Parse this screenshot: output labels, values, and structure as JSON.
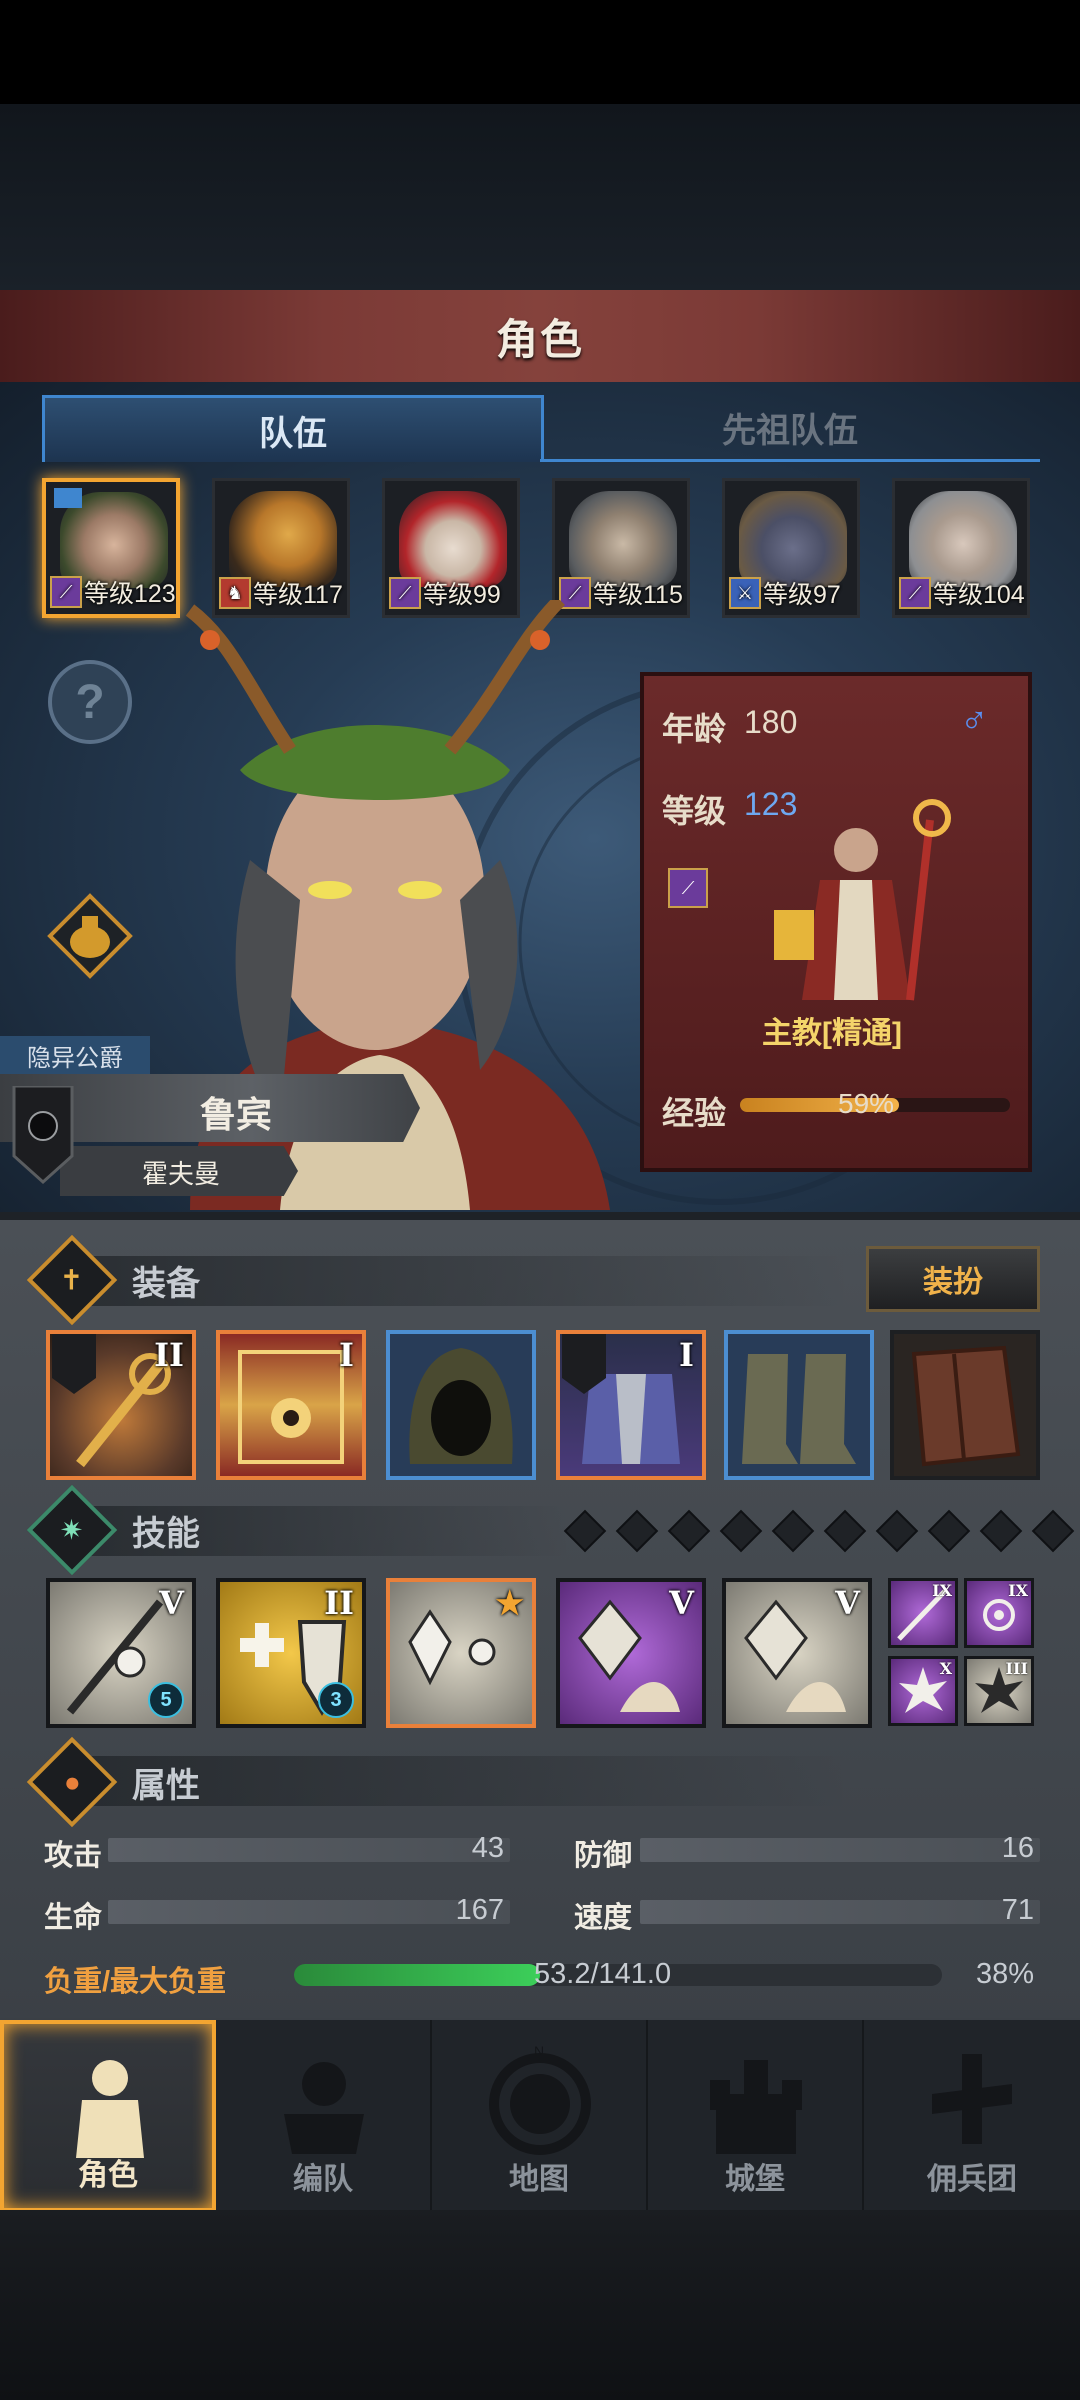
{
  "header": {
    "title": "角色"
  },
  "tabs": [
    {
      "label": "队伍",
      "active": true
    },
    {
      "label": "先祖队伍",
      "active": false
    }
  ],
  "party": [
    {
      "level_text": "等级123",
      "class_icon": "staff-icon",
      "selected": true
    },
    {
      "level_text": "等级117",
      "class_icon": "horse-icon",
      "selected": false
    },
    {
      "level_text": "等级99",
      "class_icon": "staff-icon",
      "selected": false
    },
    {
      "level_text": "等级115",
      "class_icon": "staff-icon",
      "selected": false
    },
    {
      "level_text": "等级97",
      "class_icon": "sword-icon",
      "selected": false
    },
    {
      "level_text": "等级104",
      "class_icon": "staff-icon",
      "selected": false
    }
  ],
  "character": {
    "title": "隐异公爵",
    "name": "鲁宾",
    "surname": "霍夫曼",
    "age_label": "年龄",
    "age": "180",
    "gender_symbol": "♂",
    "level_label": "等级",
    "level": "123",
    "class_name": "主教[精通]",
    "exp_label": "经验",
    "exp_percent": "59%",
    "exp_fraction": 0.59
  },
  "equipment": {
    "section_title": "装备",
    "dress_button": "装扮",
    "slots": [
      {
        "item": "staff",
        "tier": "II",
        "rarity": "orange"
      },
      {
        "item": "tome",
        "tier": "I",
        "rarity": "orange"
      },
      {
        "item": "hood",
        "tier": "",
        "rarity": "blue"
      },
      {
        "item": "armor",
        "tier": "I",
        "rarity": "orange"
      },
      {
        "item": "boots",
        "tier": "",
        "rarity": "blue"
      },
      {
        "item": "book",
        "tier": "",
        "rarity": "gray"
      }
    ]
  },
  "skills": {
    "section_title": "技能",
    "main": [
      {
        "tier": "V",
        "badge": "5"
      },
      {
        "tier": "II",
        "badge": "3"
      },
      {
        "tier": "★",
        "badge": ""
      },
      {
        "tier": "V",
        "badge": ""
      },
      {
        "tier": "V",
        "badge": ""
      }
    ],
    "mini": [
      {
        "tier": "IX"
      },
      {
        "tier": "IX"
      },
      {
        "tier": "X"
      },
      {
        "tier": "III"
      }
    ]
  },
  "attributes": {
    "section_title": "属性",
    "attack_label": "攻击",
    "attack": "43",
    "defense_label": "防御",
    "defense": "16",
    "hp_label": "生命",
    "hp": "167",
    "speed_label": "速度",
    "speed": "71",
    "load_label": "负重/最大负重",
    "load": "53.2/141.0",
    "load_percent": "38%",
    "load_fraction": 0.38
  },
  "nav": [
    {
      "label": "角色",
      "icon": "knight-icon",
      "active": true
    },
    {
      "label": "编队",
      "icon": "formation-icon",
      "active": false
    },
    {
      "label": "地图",
      "icon": "compass-icon",
      "active": false
    },
    {
      "label": "城堡",
      "icon": "castle-icon",
      "active": false
    },
    {
      "label": "佣兵团",
      "icon": "mercenary-icon",
      "active": false
    }
  ]
}
